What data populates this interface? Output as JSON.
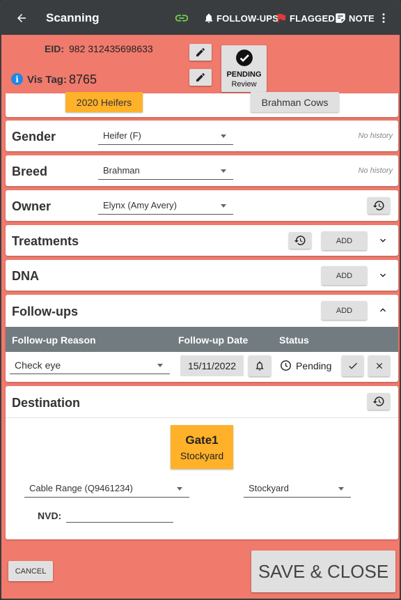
{
  "appbar": {
    "title": "Scanning",
    "follow_ups_label": "FOLLOW-UPS",
    "flagged_label": "FLAGGED",
    "note_label": "NOTE",
    "link_icon_color": "#6fd64c",
    "flag_color": "#e53935"
  },
  "header": {
    "eid_label": "EID:",
    "eid_value": "982 312435698633",
    "vis_tag_label": "Vis Tag:",
    "vis_tag_value": "8765",
    "status_main": "PENDING",
    "status_sub": "Review"
  },
  "groups": {
    "selected": "2020 Heifers",
    "other": "Brahman Cows"
  },
  "gender": {
    "label": "Gender",
    "value": "Heifer (F)",
    "history": "No history"
  },
  "breed": {
    "label": "Breed",
    "value": "Brahman",
    "history": "No history"
  },
  "owner": {
    "label": "Owner",
    "value": "Elynx (Amy  Avery)"
  },
  "treatments": {
    "label": "Treatments",
    "add_label": "ADD"
  },
  "dna": {
    "label": "DNA",
    "add_label": "ADD"
  },
  "followups": {
    "label": "Follow-ups",
    "add_label": "ADD",
    "columns": [
      "Follow-up Reason",
      "Follow-up Date",
      "Status"
    ],
    "row": {
      "reason": "Check eye",
      "date": "15/11/2022",
      "status": "Pending"
    }
  },
  "destination": {
    "label": "Destination",
    "gate_name": "Gate1",
    "gate_sub": "Stockyard",
    "property_value": "Cable Range (Q9461234)",
    "yard_value": "Stockyard",
    "nvd_label": "NVD:",
    "nvd_value": ""
  },
  "footer": {
    "cancel_label": "CANCEL",
    "save_label": "SAVE & CLOSE"
  },
  "colors": {
    "background": "#f07a6c",
    "appbar": "#3a3d40",
    "accent_orange": "#ffb12a",
    "table_header": "#727b80",
    "info_blue": "#1e88e5"
  }
}
